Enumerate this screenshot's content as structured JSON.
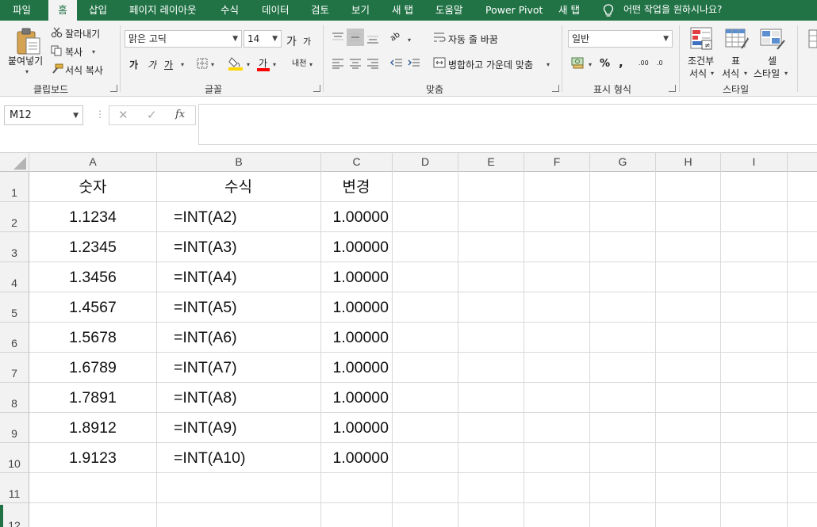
{
  "tabs": [
    "파일",
    "홈",
    "삽입",
    "페이지 레이아웃",
    "수식",
    "데이터",
    "검토",
    "보기",
    "새 탭",
    "도움말",
    "Power Pivot",
    "새 탭"
  ],
  "active_tab": "홈",
  "tell_me": "어떤 작업을 원하시나요?",
  "ribbon": {
    "clipboard": {
      "label": "클립보드",
      "paste": "붙여넣기",
      "cut": "잘라내기",
      "copy": "복사",
      "format_painter": "서식 복사"
    },
    "font": {
      "label": "글꼴",
      "font_name": "맑은 고딕",
      "font_size": "14",
      "grow": "가",
      "shrink": "가",
      "bold": "가",
      "italic": "가",
      "underline": "가",
      "font_color_glyph": "가",
      "phonetic": "내천"
    },
    "alignment": {
      "label": "맞춤",
      "wrap_text": "자동 줄 바꿈",
      "merge_center": "병합하고 가운데 맞춤",
      "orientation_glyph": "ab"
    },
    "number": {
      "label": "표시 형식",
      "format": "일반",
      "percent": "%",
      "comma": ",",
      "inc_decimal": ".00",
      "dec_decimal": ".0"
    },
    "styles": {
      "label": "스타일",
      "conditional": [
        "조건부",
        "서식"
      ],
      "table": [
        "표",
        "서식"
      ],
      "cell": [
        "셀",
        "스타일"
      ]
    }
  },
  "formula_bar": {
    "name_box": "M12",
    "cancel": "✕",
    "enter": "✓",
    "fx": "fx",
    "value": ""
  },
  "grid": {
    "columns": [
      "A",
      "B",
      "C",
      "D",
      "E",
      "F",
      "G",
      "H",
      "I"
    ],
    "rows": [
      "1",
      "2",
      "3",
      "4",
      "5",
      "6",
      "7",
      "8",
      "9",
      "10",
      "11",
      "12"
    ],
    "header_row": {
      "A": "숫자",
      "B": "수식",
      "C": "변경"
    },
    "data": [
      {
        "A": "1.1234",
        "B": "=INT(A2)",
        "C": "1.00000"
      },
      {
        "A": "1.2345",
        "B": "=INT(A3)",
        "C": "1.00000"
      },
      {
        "A": "1.3456",
        "B": "=INT(A4)",
        "C": "1.00000"
      },
      {
        "A": "1.4567",
        "B": "=INT(A5)",
        "C": "1.00000"
      },
      {
        "A": "1.5678",
        "B": "=INT(A6)",
        "C": "1.00000"
      },
      {
        "A": "1.6789",
        "B": "=INT(A7)",
        "C": "1.00000"
      },
      {
        "A": "1.7891",
        "B": "=INT(A8)",
        "C": "1.00000"
      },
      {
        "A": "1.8912",
        "B": "=INT(A9)",
        "C": "1.00000"
      },
      {
        "A": "1.9123",
        "B": "=INT(A10)",
        "C": "1.00000"
      }
    ]
  },
  "colors": {
    "accent": "#217346",
    "ribbon_bg": "#f3f3f3",
    "grid_line": "#d9d9d9",
    "header_bg": "#f2f2f2"
  }
}
